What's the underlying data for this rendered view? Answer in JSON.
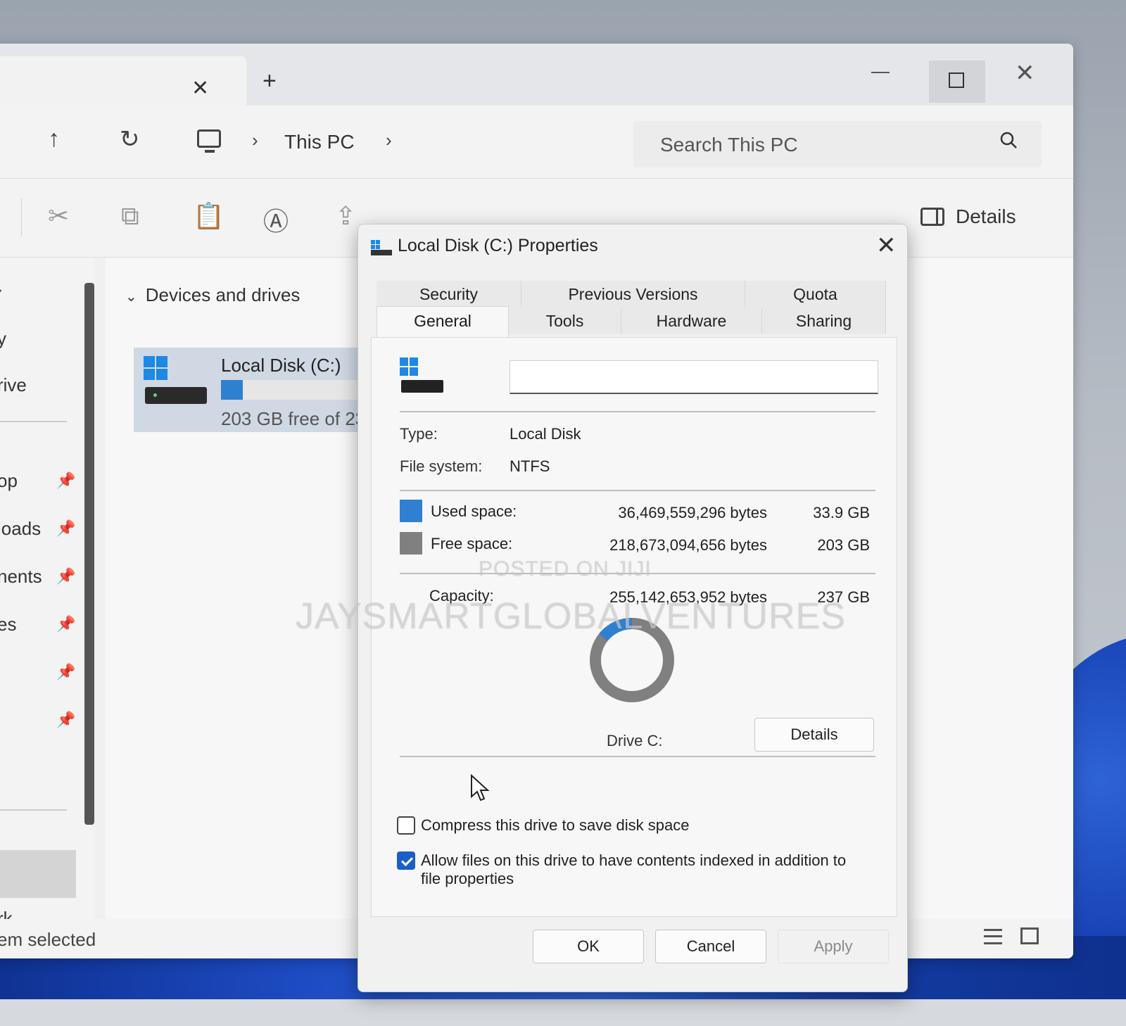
{
  "explorer": {
    "new_tab_glyph": "+",
    "close_glyph": "✕",
    "breadcrumb": "This PC",
    "search_placeholder": "Search This PC",
    "details_label": "Details",
    "section_title": "Devices and drives",
    "drive": {
      "name": "Local Disk (C:)",
      "free_text": "203 GB free of 23",
      "used_fraction": 0.143
    },
    "sidebar_items": [
      "rive",
      "op",
      "loads",
      "nents",
      "es",
      "",
      "",
      "rk"
    ],
    "status_text": "em selected"
  },
  "dialog": {
    "title": "Local Disk (C:) Properties",
    "tabs_row1": [
      "Security",
      "Previous Versions",
      "Quota"
    ],
    "tabs_row2": [
      "General",
      "Tools",
      "Hardware",
      "Sharing"
    ],
    "label_value": "",
    "type_label": "Type:",
    "type_value": "Local Disk",
    "fs_label": "File system:",
    "fs_value": "NTFS",
    "used_label": "Used space:",
    "used_bytes": "36,469,559,296 bytes",
    "used_gb": "33.9 GB",
    "free_label": "Free space:",
    "free_bytes": "218,673,094,656 bytes",
    "free_gb": "203 GB",
    "capacity_label": "Capacity:",
    "capacity_bytes": "255,142,653,952 bytes",
    "capacity_gb": "237 GB",
    "used_fraction": 0.143,
    "drive_caption": "Drive C:",
    "details_button": "Details",
    "compress_label": "Compress this drive to save disk space",
    "compress_checked": false,
    "index_label": "Allow files on this drive to have contents indexed in addition to file properties",
    "index_checked": true,
    "ok": "OK",
    "cancel": "Cancel",
    "apply": "Apply",
    "colors": {
      "used": "#2f80d0",
      "free": "#808080"
    }
  },
  "watermark": {
    "line1": "POSTED ON JIJI",
    "line2": "JAYSMARTGLOBALVENTURES"
  }
}
